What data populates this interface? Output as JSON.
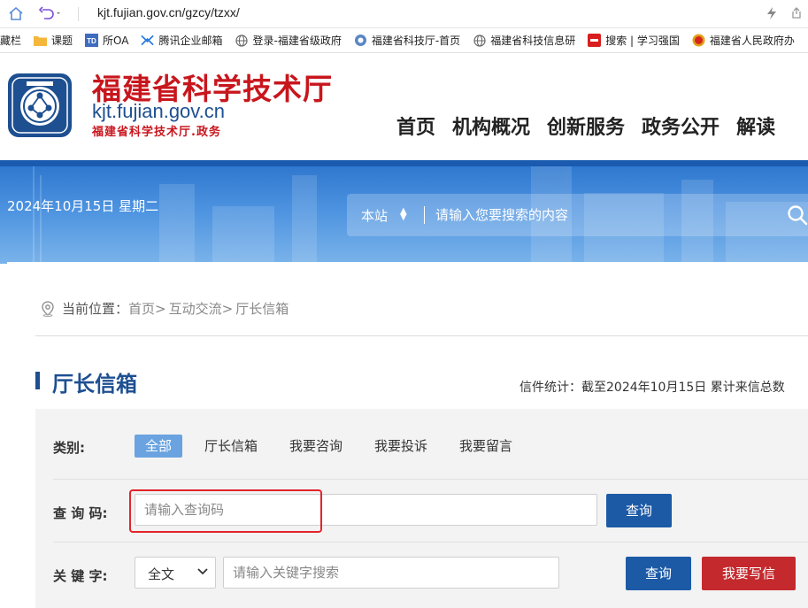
{
  "browser": {
    "url": "kjt.fujian.gov.cn/gzcy/tzxx/"
  },
  "bookmarks": [
    {
      "label": "收藏栏",
      "icon": "star-icon"
    },
    {
      "label": "课题",
      "icon": "folder-icon"
    },
    {
      "label": "所OA",
      "icon": "td-icon"
    },
    {
      "label": "腾讯企业邮箱",
      "icon": "tencent-mail-icon"
    },
    {
      "label": "登录-福建省级政府",
      "icon": "globe-icon"
    },
    {
      "label": "福建省科技厅-首页",
      "icon": "kjt-icon"
    },
    {
      "label": "福建省科技信息研",
      "icon": "globe-icon"
    },
    {
      "label": "搜索 | 学习强国",
      "icon": "xuexi-icon"
    },
    {
      "label": "福建省人民政府办",
      "icon": "emblem-icon"
    }
  ],
  "site": {
    "title": "福建省科学技术厅",
    "domain": "kjt.fujian.gov.cn",
    "subtitle": "福建省科学技术厅.政务",
    "nav": [
      "首页",
      "机构概况",
      "创新服务",
      "政务公开",
      "解读"
    ]
  },
  "banner": {
    "date": "2024年10月15日 星期二",
    "search_scope": "本站",
    "search_placeholder": "请输入您要搜索的内容"
  },
  "breadcrumb": {
    "prefix": "当前位置：",
    "items": [
      "首页",
      "互动交流",
      "厅长信箱"
    ]
  },
  "section": {
    "title": "厅长信箱",
    "stats": "信件统计：截至2024年10月15日 累计来信总数"
  },
  "filters": {
    "category_label": "类别:",
    "categories": [
      "全部",
      "厅长信箱",
      "我要咨询",
      "我要投诉",
      "我要留言"
    ],
    "query_label": "查 询 码:",
    "query_placeholder": "请输入查询码",
    "query_button": "查询",
    "keyword_label": "关 键 字:",
    "keyword_scope": "全文",
    "keyword_placeholder": "请输入关键字搜索",
    "keyword_button": "查询",
    "write_button": "我要写信"
  },
  "colors": {
    "accent_blue": "#1c5aa6",
    "brand_red": "#c8161d",
    "highlight": "#e3242b"
  }
}
